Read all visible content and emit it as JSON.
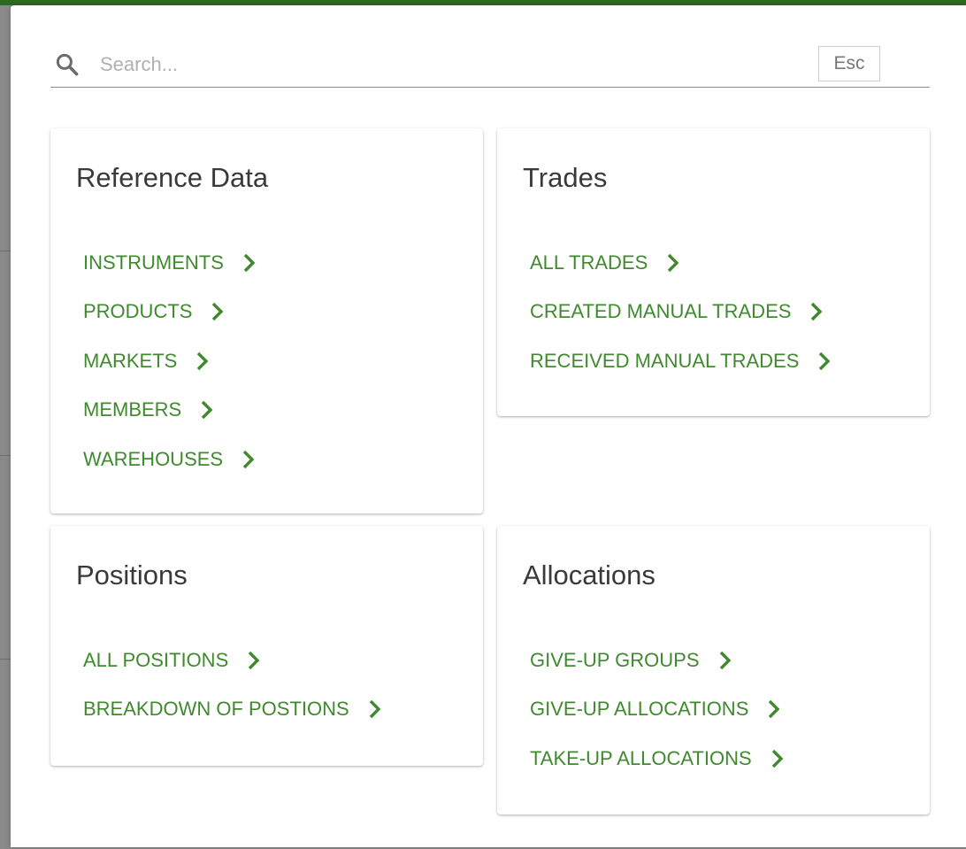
{
  "search": {
    "placeholder": "Search...",
    "esc_label": "Esc"
  },
  "colors": {
    "link": "#3f8a2e",
    "topbar": "#2e6b22",
    "title": "#3a3a3a"
  },
  "cards": {
    "reference_data": {
      "title": "Reference Data",
      "links": [
        "INSTRUMENTS",
        "PRODUCTS",
        "MARKETS",
        "MEMBERS",
        "WAREHOUSES"
      ]
    },
    "trades": {
      "title": "Trades",
      "links": [
        "ALL TRADES",
        "CREATED MANUAL TRADES",
        "RECEIVED MANUAL TRADES"
      ]
    },
    "positions": {
      "title": "Positions",
      "links": [
        "ALL POSITIONS",
        "BREAKDOWN OF POSTIONS"
      ]
    },
    "allocations": {
      "title": "Allocations",
      "links": [
        "GIVE-UP GROUPS",
        "GIVE-UP ALLOCATIONS",
        "TAKE-UP ALLOCATIONS"
      ]
    }
  },
  "icons": {
    "search": "search-icon",
    "link_arrow": "chevron-right-icon"
  }
}
